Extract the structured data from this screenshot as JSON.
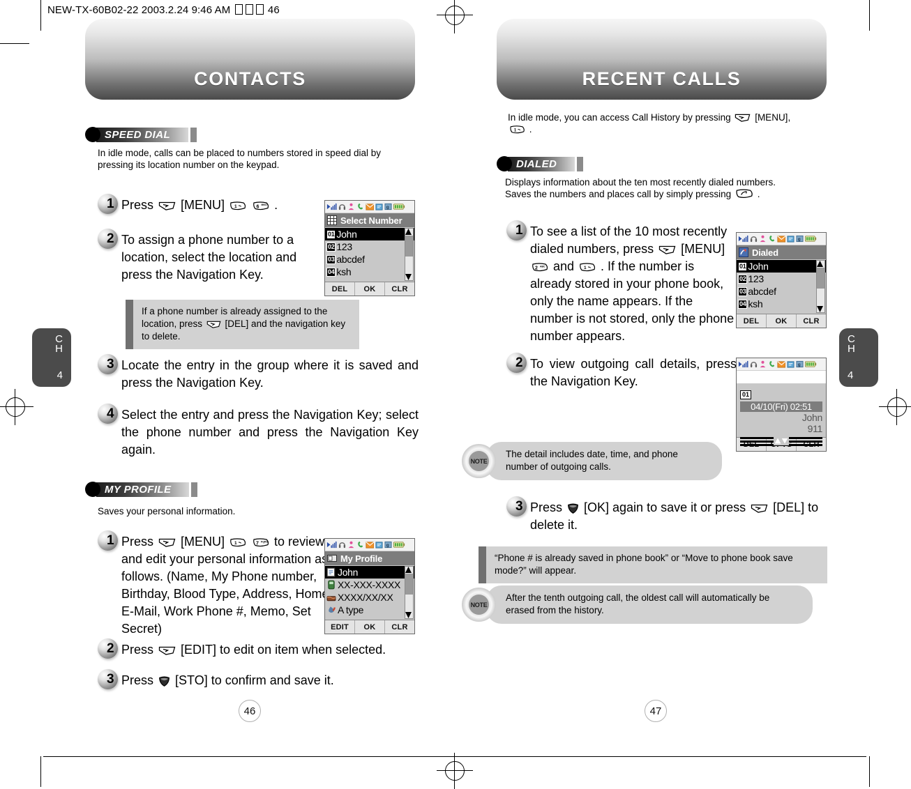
{
  "slug": {
    "text": "NEW-TX-60B02-22  2003.2.24 9:46 AM",
    "page": "46"
  },
  "left_page": {
    "banner_title": "CONTACTS",
    "chapter_tab": {
      "c": "C",
      "h": "H",
      "num": "4"
    },
    "folio": "46",
    "sections": [
      {
        "id": "speed-dial",
        "label": "SPEED DIAL",
        "intro": "In idle mode, calls can be placed to numbers stored in speed dial by pressing its location number on the keypad.",
        "steps": [
          {
            "num": "1",
            "pre": "Press",
            "keys": [
              "softkey",
              "num1",
              "num6"
            ],
            "text": "[MENU]",
            "post": "."
          },
          {
            "num": "2",
            "text": "To assign a phone number to a location, select the location and press the Navigation Key."
          },
          {
            "num": "3",
            "text": "Locate the entry in the group where it is saved and press the Navigation Key."
          },
          {
            "num": "4",
            "text": "Select the entry and press the Navigation Key; select the phone number and press the Navigation Key again."
          }
        ],
        "tip": "If a phone number is already assigned to the location, press      [DEL] and the navigation key to delete."
      },
      {
        "id": "my-profile",
        "label": "MY PROFILE",
        "intro": "Saves your personal information.",
        "steps": [
          {
            "num": "1",
            "text": "Press      [MENU]          to review and edit your personal information as follows. (Name, My Phone number, Birthday, Blood Type, Address, Home, E-Mail, Work Phone #, Memo, Set Secret)"
          },
          {
            "num": "2",
            "text": "Press      [EDIT] to edit on item when selected."
          },
          {
            "num": "3",
            "text": "Press     [STO] to confirm and save it."
          }
        ]
      }
    ],
    "screens": [
      {
        "id": "select-number",
        "title": "Select Number",
        "title_icon": "grid-icon",
        "rows": [
          {
            "idx": "01",
            "label": "John",
            "selected": true
          },
          {
            "idx": "02",
            "label": "123",
            "selected": false
          },
          {
            "idx": "03",
            "label": "abcdef",
            "selected": false
          },
          {
            "idx": "04",
            "label": "ksh",
            "selected": false
          }
        ],
        "softkeys": [
          "DEL",
          "OK",
          "CLR"
        ]
      },
      {
        "id": "my-profile-screen",
        "title": "My Profile",
        "title_icon": "card-icon",
        "rows": [
          {
            "icon": "name-icon",
            "label": "John",
            "selected": true
          },
          {
            "icon": "phone-icon",
            "label": "XX-XXX-XXXX",
            "selected": false
          },
          {
            "icon": "cake-icon",
            "label": "XXXX/XX/XX",
            "selected": false
          },
          {
            "icon": "blood-icon",
            "label": "A type",
            "selected": false
          }
        ],
        "softkeys": [
          "EDIT",
          "OK",
          "CLR"
        ]
      }
    ]
  },
  "right_page": {
    "banner_title": "RECENT CALLS",
    "chapter_tab": {
      "c": "C",
      "h": "H",
      "num": "4"
    },
    "folio": "47",
    "intro_line1": "In idle mode, you can access Call History by pressing",
    "intro_menu": "[MENU],",
    "intro_line2": ".",
    "sections": [
      {
        "id": "dialed",
        "label": "DIALED",
        "intro_line1": "Displays information about the ten most recently dialed numbers.",
        "intro_line2": "Saves the numbers and places call by simply pressing",
        "intro_end": ".",
        "steps": [
          {
            "num": "1",
            "text": "To see a list of the 10 most recently dialed numbers, press       [MENU]          and         . If the number is already stored in your phone book, only the name appears. If the number is not stored, only the phone number appears."
          },
          {
            "num": "2",
            "text": "To view outgoing call details, press the Navigation Key."
          },
          {
            "num": "3",
            "text": "Press      [OK] again to save it or press      [DEL] to delete it."
          }
        ],
        "notes": [
          {
            "badge": "NOTE",
            "text": "The detail includes date, time, and phone number of outgoing calls."
          },
          {
            "badge": "NOTE",
            "text": "After the tenth outgoing call, the oldest call will automatically be erased from the history."
          }
        ],
        "tip": "“Phone # is already saved in phone book” or “Move to phone book save mode?” will appear."
      }
    ],
    "screens": [
      {
        "id": "dialed-screen",
        "title": "Dialed",
        "title_icon": "dialed-icon",
        "rows": [
          {
            "idx": "01",
            "label": "John",
            "selected": true
          },
          {
            "idx": "02",
            "label": "123",
            "selected": false
          },
          {
            "idx": "03",
            "label": "abcdef",
            "selected": false
          },
          {
            "idx": "04",
            "label": "ksh",
            "selected": false
          }
        ],
        "softkeys": [
          "DEL",
          "OK",
          "CLR"
        ]
      },
      {
        "id": "call-detail-screen",
        "index": "01",
        "datetime": "04/10(Fri) 02:51",
        "name": "John",
        "number": "911",
        "softkeys": [
          "DEL",
          "OPTS",
          "CLR"
        ]
      }
    ]
  },
  "colors": {
    "pill_dark": "#1d1d1d",
    "tip_bg": "#d2d2d2",
    "tip_bar": "#707070",
    "screen_title_bg": "#7d7d7d",
    "screen_list_bg": "#c8c8c8",
    "chapter_tab_bg": "#4b4b4b"
  }
}
